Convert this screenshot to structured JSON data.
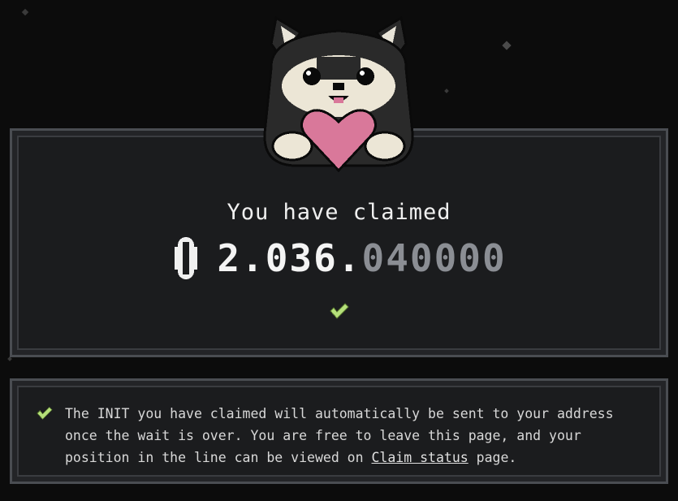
{
  "claim": {
    "title": "You have claimed",
    "amount_integer": "2.036.",
    "amount_decimal": "040000",
    "token_icon": "init-token-icon",
    "status_icon": "check-icon"
  },
  "notice": {
    "icon": "check-icon",
    "text_before": "The INIT you have claimed will automatically be sent to your address once the wait is over. You are free to leave this page, and your position in the line can be viewed on ",
    "link_text": "Claim status",
    "text_after": " page."
  },
  "colors": {
    "background": "#0c0c0c",
    "panel": "#1b1c1e",
    "border": "#4a4d52",
    "check": "#b5e07a",
    "heart": "#d9789a",
    "decimal_text": "#8b8e94"
  }
}
